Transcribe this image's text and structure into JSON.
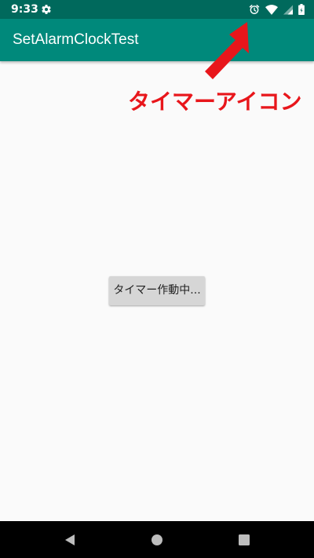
{
  "status_bar": {
    "time": "9:33",
    "icons": [
      "gear-icon",
      "alarm-clock-icon",
      "wifi-icon",
      "signal-icon",
      "battery-icon"
    ]
  },
  "app_bar": {
    "title": "SetAlarmClockTest"
  },
  "annotation": {
    "text": "タイマーアイコン",
    "color": "#e8161b"
  },
  "main": {
    "button_label": "タイマー作動中..."
  },
  "nav_bar": {
    "icons": [
      "back-icon",
      "home-icon",
      "recents-icon"
    ]
  },
  "colors": {
    "status_bar": "#00695c",
    "app_bar": "#00897b",
    "background": "#fafafa",
    "button": "#d6d6d6"
  }
}
